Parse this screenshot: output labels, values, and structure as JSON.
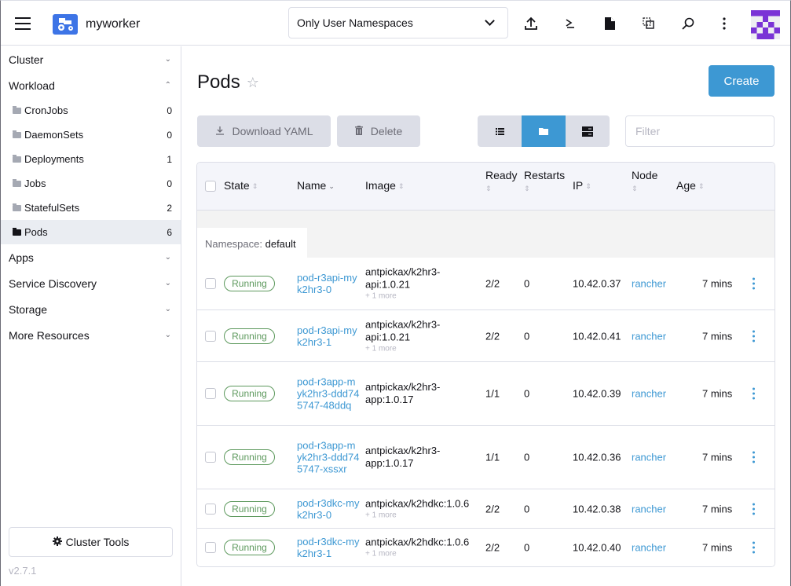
{
  "header": {
    "cluster_name": "myworker",
    "namespace_filter": "Only User Namespaces",
    "icons": [
      "upload-icon",
      "kubectl-shell-icon",
      "file-icon",
      "copy-kubeconfig-icon",
      "search-icon",
      "more-vertical-icon"
    ]
  },
  "sidebar": {
    "groups": {
      "cluster": "Cluster",
      "workload": "Workload",
      "apps": "Apps",
      "service_discovery": "Service Discovery",
      "storage": "Storage",
      "more_resources": "More Resources"
    },
    "workload_items": [
      {
        "label": "CronJobs",
        "count": "0"
      },
      {
        "label": "DaemonSets",
        "count": "0"
      },
      {
        "label": "Deployments",
        "count": "1"
      },
      {
        "label": "Jobs",
        "count": "0"
      },
      {
        "label": "StatefulSets",
        "count": "2"
      },
      {
        "label": "Pods",
        "count": "6",
        "active": true
      }
    ],
    "cluster_tools": "Cluster Tools",
    "version": "v2.7.1"
  },
  "main": {
    "title": "Pods",
    "create_label": "Create",
    "download_yaml_label": "Download YAML",
    "delete_label": "Delete",
    "filter_placeholder": "Filter",
    "view_mode": "group-by-namespace",
    "columns": {
      "state": "State",
      "name": "Name",
      "image": "Image",
      "ready": "Ready",
      "restarts": "Restarts",
      "ip": "IP",
      "node": "Node",
      "age": "Age"
    },
    "namespace_label": "Namespace:",
    "namespace": "default",
    "rows": [
      {
        "state": "Running",
        "name": "pod-r3api-myk2hr3-0",
        "image": "antpickax/k2hr3-api:1.0.21",
        "more": "+ 1 more",
        "ready": "2/2",
        "restarts": "0",
        "ip": "10.42.0.37",
        "node": "rancher",
        "age": "7 mins"
      },
      {
        "state": "Running",
        "name": "pod-r3api-myk2hr3-1",
        "image": "antpickax/k2hr3-api:1.0.21",
        "more": "+ 1 more",
        "ready": "2/2",
        "restarts": "0",
        "ip": "10.42.0.41",
        "node": "rancher",
        "age": "7 mins"
      },
      {
        "state": "Running",
        "name": "pod-r3app-myk2hr3-ddd745747-48ddq",
        "image": "antpickax/k2hr3-app:1.0.17",
        "more": "",
        "ready": "1/1",
        "restarts": "0",
        "ip": "10.42.0.39",
        "node": "rancher",
        "age": "7 mins"
      },
      {
        "state": "Running",
        "name": "pod-r3app-myk2hr3-ddd745747-xssxr",
        "image": "antpickax/k2hr3-app:1.0.17",
        "more": "",
        "ready": "1/1",
        "restarts": "0",
        "ip": "10.42.0.36",
        "node": "rancher",
        "age": "7 mins"
      },
      {
        "state": "Running",
        "name": "pod-r3dkc-myk2hr3-0",
        "image": "antpickax/k2hdkc:1.0.6",
        "more": "+ 1 more",
        "ready": "2/2",
        "restarts": "0",
        "ip": "10.42.0.38",
        "node": "rancher",
        "age": "7 mins"
      },
      {
        "state": "Running",
        "name": "pod-r3dkc-myk2hr3-1",
        "image": "antpickax/k2hdkc:1.0.6",
        "more": "+ 1 more",
        "ready": "2/2",
        "restarts": "0",
        "ip": "10.42.0.40",
        "node": "rancher",
        "age": "7 mins"
      }
    ]
  },
  "colors": {
    "accent": "#3d98d3",
    "cluster_logo": "#3d74e6",
    "running": "#5d995d",
    "avatar": "#7a33d6"
  }
}
